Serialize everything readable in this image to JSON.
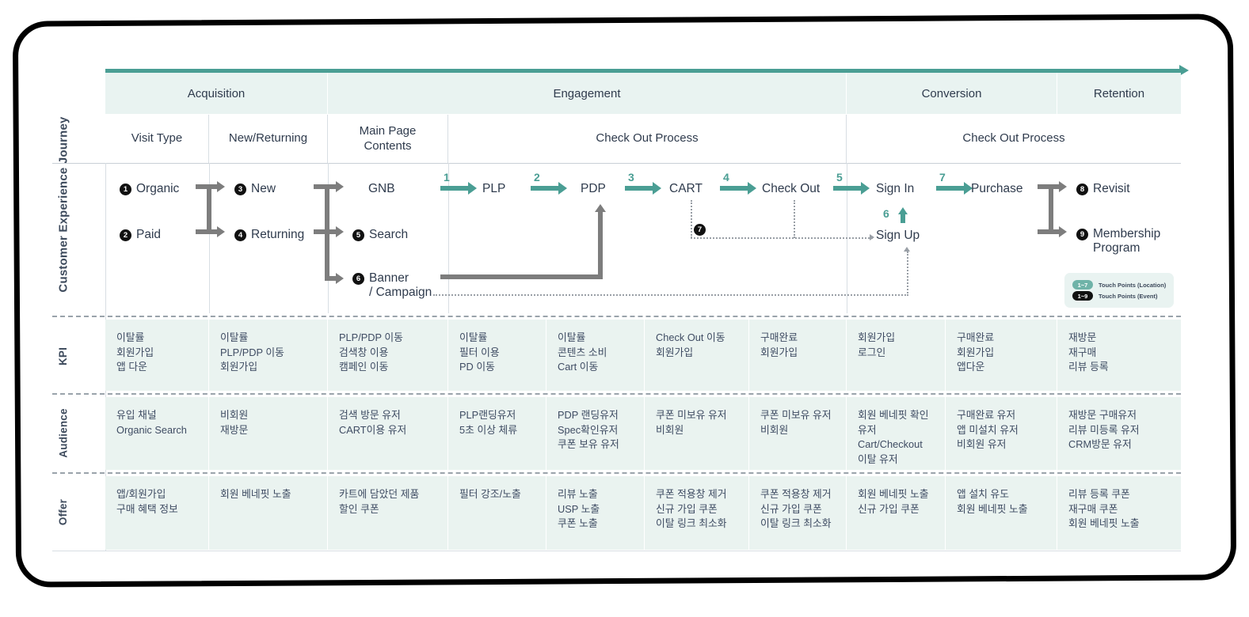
{
  "diagram": {
    "row_labels": {
      "journey": "Customer Experience Journey",
      "kpi": "KPI",
      "audience": "Audience",
      "offer": "Offer"
    },
    "stages": [
      {
        "label": "Acquisition"
      },
      {
        "label": "Engagement"
      },
      {
        "label": "Conversion"
      },
      {
        "label": "Retention"
      }
    ],
    "subheaders": [
      {
        "label": "Visit Type"
      },
      {
        "label": "New/Returning"
      },
      {
        "label": "Main Page\nContents"
      },
      {
        "label": "Check Out Process"
      },
      {
        "label": "Check Out Process"
      }
    ],
    "nodes": {
      "organic": {
        "num": "1",
        "label": "Organic"
      },
      "paid": {
        "num": "2",
        "label": "Paid"
      },
      "new": {
        "num": "3",
        "label": "New"
      },
      "returning": {
        "num": "4",
        "label": "Returning"
      },
      "gnb": {
        "label": "GNB"
      },
      "search": {
        "num": "5",
        "label": "Search"
      },
      "banner": {
        "num": "6",
        "label": "Banner\n/ Campaign"
      },
      "plp": {
        "label": "PLP"
      },
      "pdp": {
        "label": "PDP"
      },
      "cart": {
        "label": "CART"
      },
      "checkout": {
        "label": "Check Out"
      },
      "signin": {
        "label": "Sign In"
      },
      "signup": {
        "label": "Sign Up"
      },
      "purchase": {
        "label": "Purchase"
      },
      "revisit": {
        "num": "8",
        "label": "Revisit"
      },
      "membership": {
        "num": "9",
        "label": "Membership\nProgram"
      },
      "cart_event": {
        "num": "7"
      }
    },
    "step_numbers": {
      "s1": "1",
      "s2": "2",
      "s3": "3",
      "s4": "4",
      "s5": "5",
      "s6": "6",
      "s7": "7"
    },
    "legend": [
      {
        "pill": "1~7",
        "text": "Touch Points (Location)",
        "color": "#6fb3a8"
      },
      {
        "pill": "1~9",
        "text": "Touch Points (Event)",
        "color": "#111111"
      }
    ],
    "colors": {
      "teal": "#4a9e94",
      "band": "#e9f3f1",
      "cell": "#eaf3f0",
      "text": "#3f4c63",
      "grey_arrow": "#7d7d7d"
    },
    "matrix": {
      "kpi": [
        "이탈률\n회원가입\n앱 다운",
        "이탈률\nPLP/PDP 이동\n회원가입",
        "PLP/PDP 이동\n검색창 이용\n캠페인 이동",
        "이탈률\n필터 이용\nPD 이동",
        "이탈률\n콘텐츠 소비\nCart 이동",
        "Check Out 이동\n회원가입",
        "구매완료\n회원가입",
        "회원가입\n로그인",
        "구매완료\n회원가입\n앱다운",
        "재방문\n재구매\n리뷰 등록"
      ],
      "audience": [
        "유입 채널\nOrganic Search",
        "비회원\n재방문",
        "검색 방문 유저\nCART이용 유저",
        "PLP랜딩유저\n5초 이상 체류",
        "PDP 랜딩유저\nSpec확인유저\n쿠폰 보유 유저",
        "쿠폰 미보유 유저\n비회원",
        "쿠폰 미보유 유저\n비회원",
        "회원 베네핏 확인\n유저\nCart/Checkout\n이탈 유저",
        "구매완료 유저\n앱 미설치 유저\n비회원 유저",
        "재방문 구매유저\n리뷰 미등록 유저\nCRM방문 유저"
      ],
      "offer": [
        "앱/회원가입\n구매 혜택 정보",
        "회원 베네핏 노출",
        "카트에 담았던 제품\n할인 쿠폰",
        "필터 강조/노출",
        "리뷰 노출\nUSP 노출\n쿠폰 노출",
        "쿠폰 적용창 제거\n신규 가입 쿠폰\n이탈 링크 최소화",
        "쿠폰 적용창 제거\n신규 가입 쿠폰\n이탈 링크 최소화",
        "회원 베네핏 노출\n신규 가입 쿠폰",
        "앱 설치 유도\n회원 베네핏 노출",
        "리뷰 등록 쿠폰\n재구매 쿠폰\n회원 베네핏 노출"
      ]
    }
  }
}
